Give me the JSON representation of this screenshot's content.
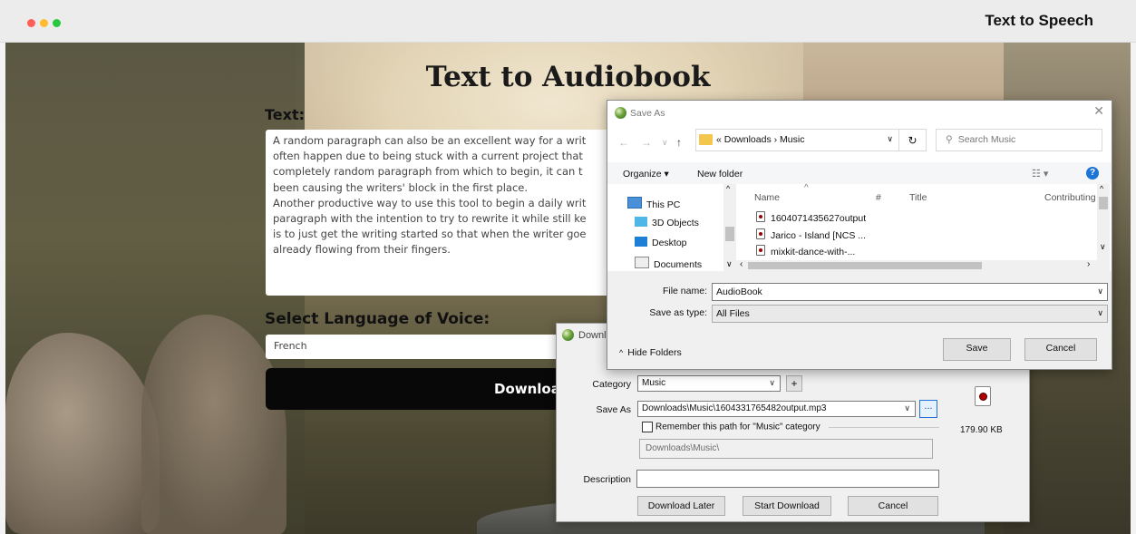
{
  "window": {
    "title": "Text to Speech",
    "traffic_lights": [
      "#ff5f57",
      "#febc2e",
      "#28c840"
    ]
  },
  "page": {
    "heading": "Text to Audiobook",
    "text_label": "Text:",
    "text_content": "A random paragraph can also be an excellent way for a writ\noften happen due to being stuck with a current project that\ncompletely random paragraph from which to begin, it can t\nbeen causing the writers' block in the first place.\nAnother productive way to use this tool to begin a daily writ\nparagraph with the intention to try to rewrite it while still ke\nis to just get the writing started so that when the writer goe\nalready flowing from their fingers.",
    "language_label": "Select Language of Voice:",
    "language_value": "French",
    "download_button": "Downloa"
  },
  "download_dialog": {
    "title": "Downl",
    "category_label": "Category",
    "category_value": "Music",
    "add_button": "+",
    "save_as_label": "Save As",
    "save_as_value": "Downloads\\Music\\1604331765482output.mp3",
    "browse_button": "...",
    "remember_label": "Remember this path for \"Music\" category",
    "path_value": "Downloads\\Music\\",
    "description_label": "Description",
    "description_value": "",
    "file_size": "179.90 KB",
    "buttons": {
      "later": "Download Later",
      "start": "Start Download",
      "cancel": "Cancel"
    }
  },
  "save_as_dialog": {
    "title": "Save As",
    "close": "✕",
    "breadcrumb": "«  Downloads  ›  Music",
    "search_placeholder": "Search Music",
    "toolbar": {
      "organize": "Organize ▾",
      "new_folder": "New folder",
      "view": "☷ ▾",
      "help": "?"
    },
    "nav_items": [
      "This PC",
      "3D Objects",
      "Desktop",
      "Documents"
    ],
    "columns": [
      "Name",
      "#",
      "Title",
      "Contributing"
    ],
    "files": [
      "1604071435627output",
      "Jarico - Island [NCS ...",
      "mixkit-dance-with-..."
    ],
    "file_name_label": "File name:",
    "file_name_value": "AudioBook",
    "save_type_label": "Save as type:",
    "save_type_value": "All Files",
    "hide_folders": "Hide Folders",
    "save_button": "Save",
    "cancel_button": "Cancel"
  }
}
